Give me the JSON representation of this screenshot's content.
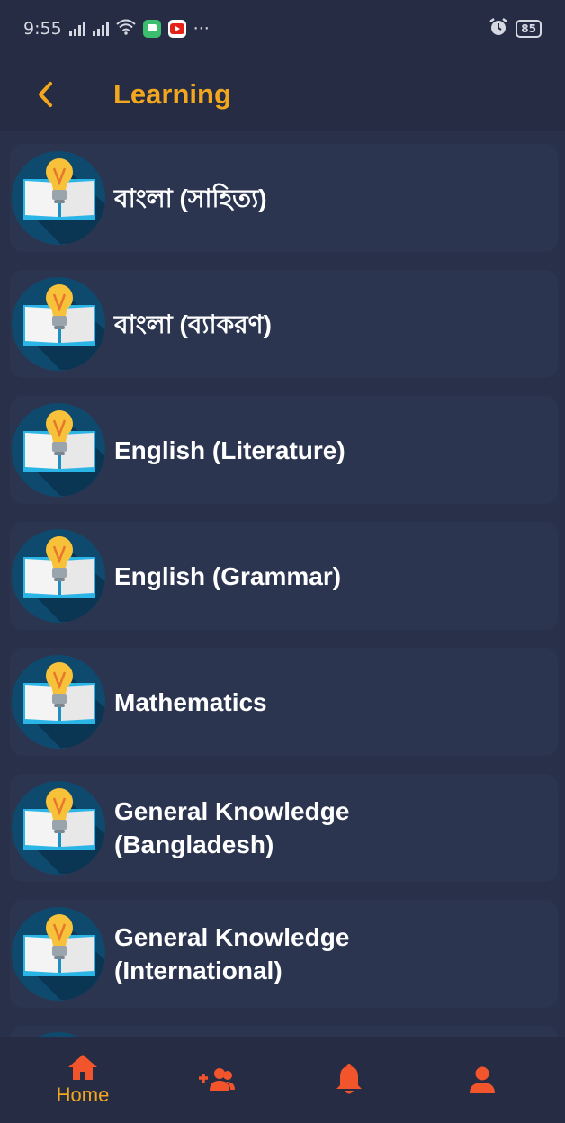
{
  "status_bar": {
    "time": "9:55",
    "more": "···",
    "battery": "85",
    "icons": [
      "signal-icon",
      "signal-icon",
      "wifi-icon",
      "messages-app-icon",
      "youtube-app-icon",
      "alarm-icon",
      "battery-icon"
    ]
  },
  "header": {
    "title": "Learning",
    "back_icon": "chevron-left-icon"
  },
  "list": {
    "items": [
      {
        "label": "বাংলা (সাহিত্য)"
      },
      {
        "label": "বাংলা (ব্যাকরণ)"
      },
      {
        "label": "English (Literature)"
      },
      {
        "label": "English (Grammar)"
      },
      {
        "label": "Mathematics"
      },
      {
        "label": "General Knowledge (Bangladesh)"
      },
      {
        "label": "General Knowledge (International)"
      }
    ],
    "item_icon": "lightbulb-book-icon"
  },
  "bottom_nav": {
    "items": [
      {
        "label": "Home",
        "icon": "home-icon",
        "active": true
      },
      {
        "label": "",
        "icon": "add-friend-icon",
        "active": false
      },
      {
        "label": "",
        "icon": "bell-icon",
        "active": false
      },
      {
        "label": "",
        "icon": "profile-icon",
        "active": false
      }
    ]
  },
  "colors": {
    "background": "#28304a",
    "card": "#2c3550",
    "accent_yellow": "#f2a71f",
    "accent_orange": "#f2552c",
    "icon_circle": "#0d4a6e"
  }
}
